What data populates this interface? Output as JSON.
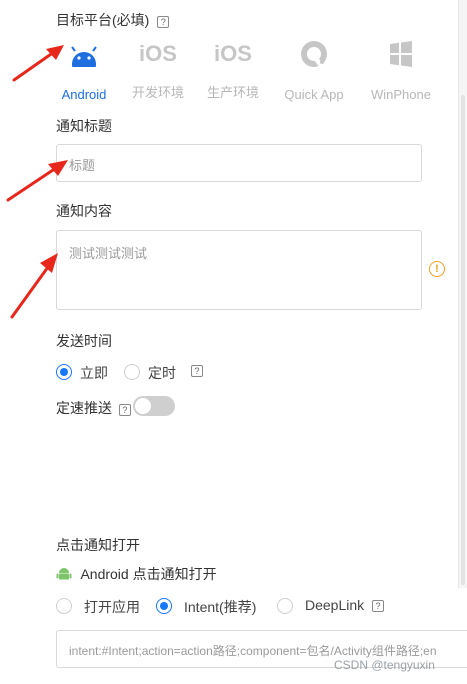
{
  "target_platform": {
    "label": "目标平台(必填)",
    "help": "?",
    "platforms": [
      {
        "label": "Android",
        "icon": "android-icon",
        "active": true
      },
      {
        "label": "开发环境",
        "icon": "ios-icon",
        "glyph": "iOS",
        "active": false
      },
      {
        "label": "生产环境",
        "icon": "ios-icon",
        "glyph": "iOS",
        "active": false
      },
      {
        "label": "Quick App",
        "icon": "quickapp-icon",
        "active": false
      },
      {
        "label": "WinPhone",
        "icon": "windows-icon",
        "active": false
      }
    ]
  },
  "notification_title": {
    "label": "通知标题",
    "placeholder": "标题"
  },
  "notification_content": {
    "label": "通知内容",
    "placeholder": "测试测试测试"
  },
  "send_time": {
    "label": "发送时间",
    "options": [
      {
        "label": "立即",
        "selected": true
      },
      {
        "label": "定时",
        "selected": false
      }
    ],
    "help": "?"
  },
  "rate_push": {
    "label": "定速推送",
    "help": "?",
    "enabled": false
  },
  "click_action": {
    "label": "点击通知打开",
    "android_label": "Android 点击通知打开",
    "options": [
      {
        "label": "打开应用",
        "selected": false
      },
      {
        "label": "Intent(推荐)",
        "selected": true
      },
      {
        "label": "DeepLink",
        "selected": false
      }
    ],
    "help": "?",
    "intent_placeholder": "intent:#Intent;action=action路径;component=包名/Activity组件路径;en"
  },
  "watermark": "CSDN @tengyuxin",
  "colors": {
    "accent": "#1677ff",
    "android_active": "#1f6ee0",
    "arrow": "#e8271c",
    "warning": "#f0a020"
  }
}
